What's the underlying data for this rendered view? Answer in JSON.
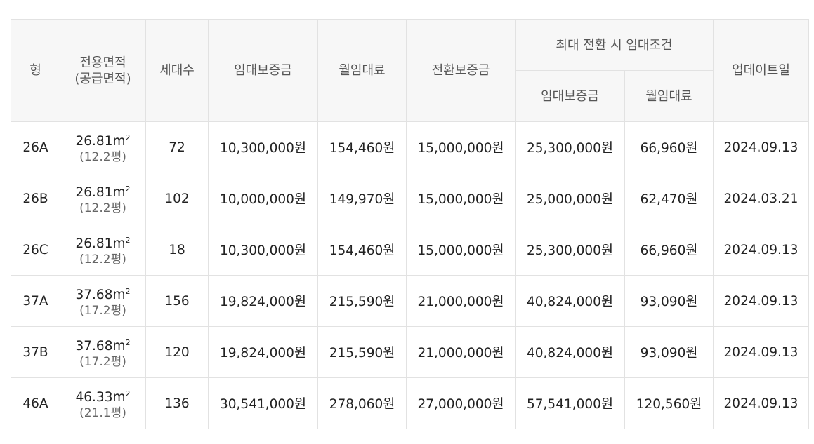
{
  "headers": {
    "type": "형",
    "area_line1": "전용면적",
    "area_line2": "(공급면적)",
    "households": "세대수",
    "deposit": "임대보증금",
    "monthly_rent": "월임대료",
    "conversion_deposit": "전환보증금",
    "max_conversion_group": "최대 전환 시 임대조건",
    "max_deposit": "임대보증금",
    "max_monthly_rent": "월임대료",
    "updated": "업데이트일"
  },
  "rows": [
    {
      "type": "26A",
      "area": "26.81m",
      "area_sup": "2",
      "supply": "(12.2평)",
      "households": "72",
      "deposit": "10,300,000원",
      "rent": "154,460원",
      "conversion": "15,000,000원",
      "max_deposit": "25,300,000원",
      "max_rent": "66,960원",
      "updated": "2024.09.13"
    },
    {
      "type": "26B",
      "area": "26.81m",
      "area_sup": "2",
      "supply": "(12.2평)",
      "households": "102",
      "deposit": "10,000,000원",
      "rent": "149,970원",
      "conversion": "15,000,000원",
      "max_deposit": "25,000,000원",
      "max_rent": "62,470원",
      "updated": "2024.03.21"
    },
    {
      "type": "26C",
      "area": "26.81m",
      "area_sup": "2",
      "supply": "(12.2평)",
      "households": "18",
      "deposit": "10,300,000원",
      "rent": "154,460원",
      "conversion": "15,000,000원",
      "max_deposit": "25,300,000원",
      "max_rent": "66,960원",
      "updated": "2024.09.13"
    },
    {
      "type": "37A",
      "area": "37.68m",
      "area_sup": "2",
      "supply": "(17.2평)",
      "households": "156",
      "deposit": "19,824,000원",
      "rent": "215,590원",
      "conversion": "21,000,000원",
      "max_deposit": "40,824,000원",
      "max_rent": "93,090원",
      "updated": "2024.09.13"
    },
    {
      "type": "37B",
      "area": "37.68m",
      "area_sup": "2",
      "supply": "(17.2평)",
      "households": "120",
      "deposit": "19,824,000원",
      "rent": "215,590원",
      "conversion": "21,000,000원",
      "max_deposit": "40,824,000원",
      "max_rent": "93,090원",
      "updated": "2024.09.13"
    },
    {
      "type": "46A",
      "area": "46.33m",
      "area_sup": "2",
      "supply": "(21.1평)",
      "households": "136",
      "deposit": "30,541,000원",
      "rent": "278,060원",
      "conversion": "27,000,000원",
      "max_deposit": "57,541,000원",
      "max_rent": "120,560원",
      "updated": "2024.09.13"
    }
  ]
}
